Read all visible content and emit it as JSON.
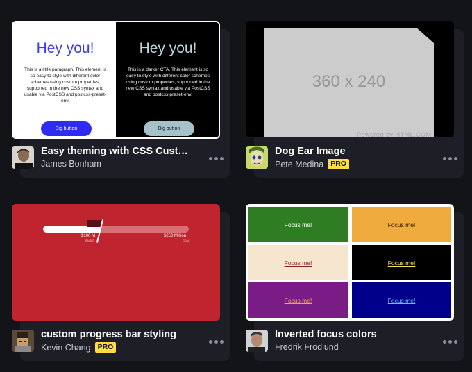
{
  "cards": [
    {
      "title": "Easy theming with CSS Custom ...",
      "author": "James Bonham",
      "pro": "",
      "preview": {
        "light": {
          "heading": "Hey you!",
          "text": "This is a little paragraph. This element is so easy to style with different color schemes using custom properties, supported in the new CSS syntax and usable via PostCSS and postcss-preset-env.",
          "button": "Big button"
        },
        "dark": {
          "heading": "Hey you!",
          "text": "This is a darker CTA. This element is so easy to style with different color schemes using custom properties, supported in the new CSS syntax and usable via PostCSS and postcss-preset-env.",
          "button": "Big button"
        }
      }
    },
    {
      "title": "Dog Ear Image",
      "author": "Pete Medina",
      "pro": "PRO",
      "preview": {
        "dimensions": "360 x 240",
        "watermark": "Powered by HTML.COM"
      }
    },
    {
      "title": "custom progress bar styling",
      "author": "Kevin Chang",
      "pro": "PRO",
      "preview": {
        "progress_fraction": 0.4,
        "current_label": "$100 M",
        "current_sub": "RAISED",
        "goal_label": "$250 Million",
        "goal_sub": "GOAL"
      }
    },
    {
      "title": "Inverted focus colors",
      "author": "Fredrik Frodlund",
      "pro": "",
      "preview": {
        "link_text": "Focus me!",
        "cells": [
          {
            "bg": "#2e7d22",
            "fg": "#ffffff"
          },
          {
            "bg": "#f0ab3e",
            "fg": "#3b2204"
          },
          {
            "bg": "#f6e6d0",
            "fg": "#8b1a1a"
          },
          {
            "bg": "#000000",
            "fg": "#f7e24a"
          },
          {
            "bg": "#7a1c86",
            "fg": "#f0a24a"
          },
          {
            "bg": "#00008b",
            "fg": "#6ab8ff"
          }
        ]
      }
    }
  ],
  "colors": {
    "background": "#131417",
    "card_back": "#1e1f26",
    "pro_badge": "#ffdd40"
  },
  "icons": [
    "more-dots-icon"
  ]
}
